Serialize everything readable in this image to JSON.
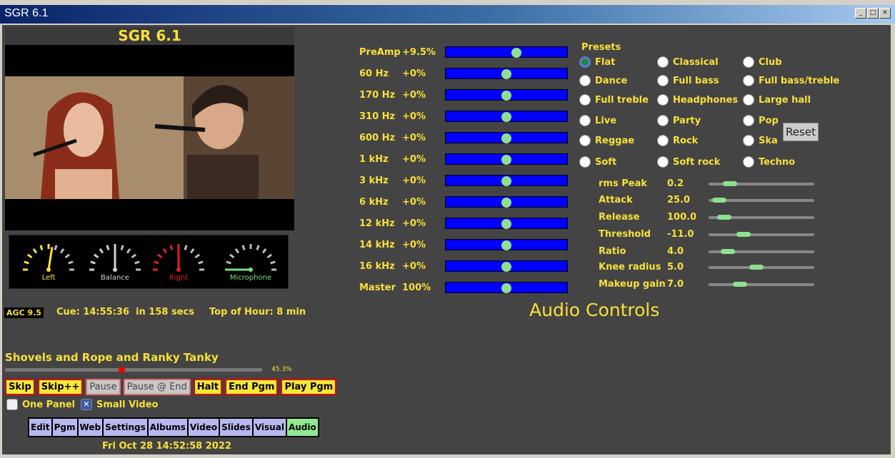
{
  "window": {
    "title": "SGR 6.1",
    "buttons": [
      "_",
      "□",
      "×"
    ]
  },
  "video": {
    "title": "SGR 6.1"
  },
  "meters": [
    {
      "label": "Left",
      "color": "#f8e038",
      "level": 0.55
    },
    {
      "label": "Balance",
      "color": "#cfcfcf",
      "level": 0.5
    },
    {
      "label": "Right",
      "color": "#e02020",
      "level": 0.5
    },
    {
      "label": "Microphone",
      "color": "#7be07b",
      "level": 0.0
    }
  ],
  "status": {
    "agc": "AGC 9.5",
    "cue": "Cue: 14:55:36  in 158 secs",
    "top_of_hour": "Top of Hour: 8 min"
  },
  "now_playing": {
    "title": "Shovels and Rope and Ranky Tanky",
    "progress_label": "45.3%",
    "progress": 0.453
  },
  "buttons": {
    "skip": "Skip",
    "skipplus": "Skip++",
    "pause": "Pause",
    "pause_end": "Pause @ End",
    "halt": "Halt",
    "end_pgm": "End Pgm",
    "play_pgm": "Play Pgm"
  },
  "options": {
    "one_panel": {
      "label": "One Panel",
      "checked": false
    },
    "small_video": {
      "label": "Small Video",
      "checked": true
    }
  },
  "tabs": [
    "Edit",
    "Pgm",
    "Web",
    "Settings",
    "Albums",
    "Video",
    "Slides",
    "Visual",
    "Audio"
  ],
  "active_tab": "Audio",
  "datetime": "Fri Oct 28 14:52:58 2022",
  "eq": [
    {
      "band": "PreAmp",
      "value": "+9.5%",
      "pos": 0.58
    },
    {
      "band": "60 Hz",
      "value": "+0%",
      "pos": 0.5
    },
    {
      "band": "170 Hz",
      "value": "+0%",
      "pos": 0.5
    },
    {
      "band": "310 Hz",
      "value": "+0%",
      "pos": 0.5
    },
    {
      "band": "600 Hz",
      "value": "+0%",
      "pos": 0.5
    },
    {
      "band": "1 kHz",
      "value": "+0%",
      "pos": 0.5
    },
    {
      "band": "3 kHz",
      "value": "+0%",
      "pos": 0.5
    },
    {
      "band": "6 kHz",
      "value": "+0%",
      "pos": 0.5
    },
    {
      "band": "12 kHz",
      "value": "+0%",
      "pos": 0.5
    },
    {
      "band": "14 kHz",
      "value": "+0%",
      "pos": 0.5
    },
    {
      "band": "16 kHz",
      "value": "+0%",
      "pos": 0.5
    },
    {
      "band": "Master",
      "value": "100%",
      "pos": 0.5
    }
  ],
  "presets": {
    "title": "Presets",
    "selected": "Flat",
    "items": [
      "Flat",
      "Classical",
      "Club",
      "Dance",
      "Full bass",
      "Full bass/treble",
      "Full treble",
      "Headphones",
      "Large hall",
      "Live",
      "Party",
      "Pop",
      "Reggae",
      "Rock",
      "Ska",
      "Soft",
      "Soft rock",
      "Techno"
    ],
    "reset": "Reset"
  },
  "compressor": [
    {
      "label": "rms Peak",
      "value": "0.2",
      "pos": 0.2
    },
    {
      "label": "Attack",
      "value": "25.0",
      "pos": 0.1
    },
    {
      "label": "Release",
      "value": "100.0",
      "pos": 0.15
    },
    {
      "label": "Threshold",
      "value": "-11.0",
      "pos": 0.33
    },
    {
      "label": "Ratio",
      "value": "4.0",
      "pos": 0.18
    },
    {
      "label": "Knee radius",
      "value": "5.0",
      "pos": 0.45
    },
    {
      "label": "Makeup gain",
      "value": "7.0",
      "pos": 0.3
    }
  ],
  "audio_title": "Audio Controls"
}
